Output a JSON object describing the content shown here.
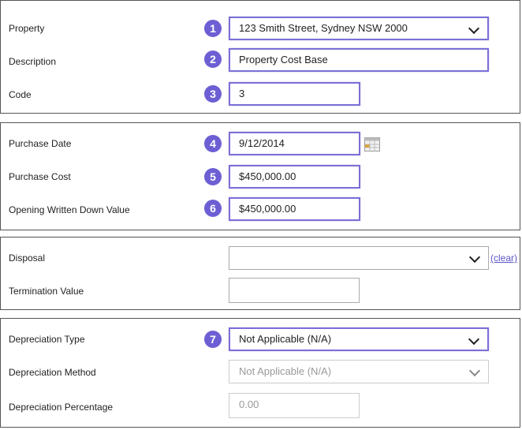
{
  "general": {
    "property_label": "Property",
    "property_value": "123 Smith Street, Sydney NSW 2000",
    "description_label": "Description",
    "description_value": "Property Cost Base",
    "code_label": "Code",
    "code_value": "3"
  },
  "purchase": {
    "date_label": "Purchase Date",
    "date_value": "9/12/2014",
    "cost_label": "Purchase Cost",
    "cost_value": "$450,000.00",
    "owdv_label": "Opening Written Down Value",
    "owdv_value": "$450,000.00"
  },
  "disposal": {
    "disposal_label": "Disposal",
    "disposal_value": "",
    "clear_link": "(clear)",
    "termination_label": "Termination Value",
    "termination_value": ""
  },
  "depreciation": {
    "type_label": "Depreciation Type",
    "type_value": "Not Applicable (N/A)",
    "method_label": "Depreciation Method",
    "method_value": "Not Applicable (N/A)",
    "percentage_label": "Depreciation Percentage",
    "percentage_placeholder": "0.00"
  },
  "badges": [
    "1",
    "2",
    "3",
    "4",
    "5",
    "6",
    "7"
  ],
  "colors": {
    "highlight": "#7b6fd6",
    "badge": "#6d5fd3",
    "link": "#5a55c8"
  },
  "icons": {
    "dropdown": "chevron-down-icon",
    "calendar": "calendar-icon"
  }
}
